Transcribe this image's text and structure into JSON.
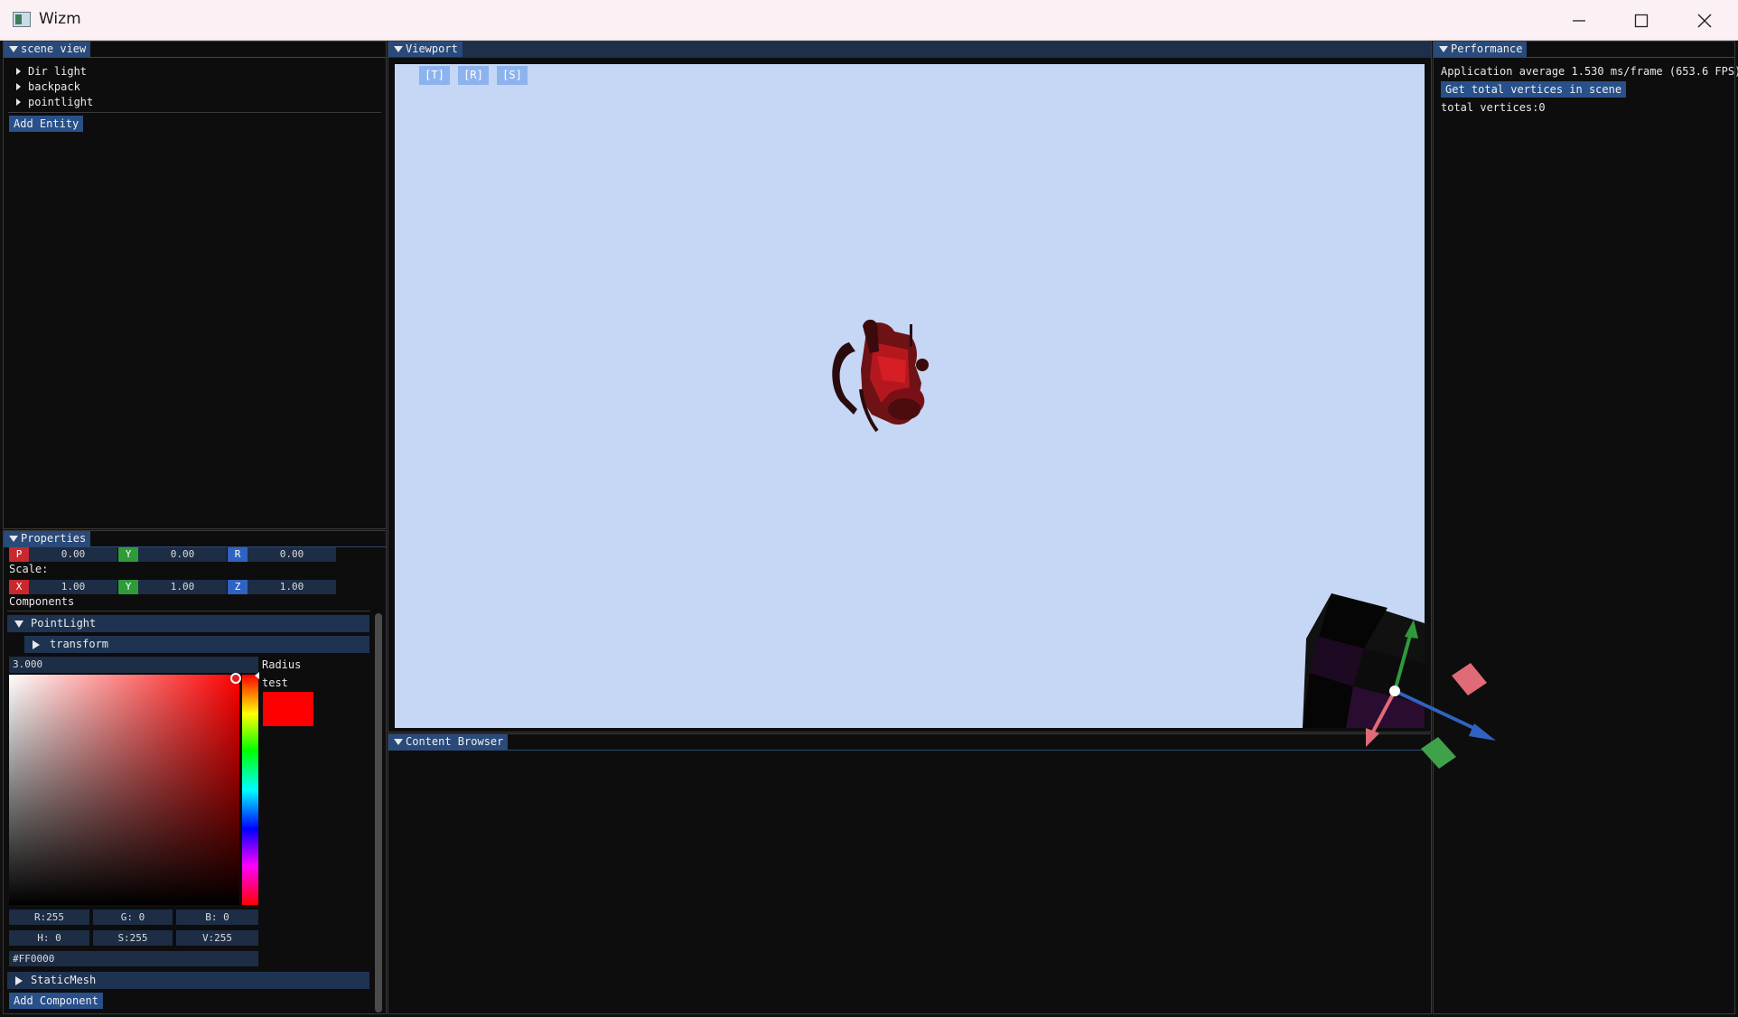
{
  "window": {
    "title": "Wizm",
    "minimize_icon": "minimize-icon",
    "maximize_icon": "maximize-icon",
    "close_icon": "close-icon"
  },
  "scene_view": {
    "tab": "scene view",
    "entities": [
      {
        "label": "Dir light"
      },
      {
        "label": "backpack"
      },
      {
        "label": "pointlight"
      }
    ],
    "add_entity": "Add Entity"
  },
  "properties": {
    "tab": "Properties",
    "position": {
      "label_x": "P",
      "x": "0.00",
      "label_y": "Y",
      "y": "0.00",
      "label_z": "R",
      "z": "0.00"
    },
    "scale_label": "Scale:",
    "scale": {
      "label_x": "X",
      "x": "1.00",
      "label_y": "Y",
      "y": "1.00",
      "label_z": "Z",
      "z": "1.00"
    },
    "components_label": "Components",
    "point_light": {
      "header": "PointLight",
      "transform_header": "transform",
      "radius_value": "3.000",
      "radius_label": "Radius",
      "color_label": "test",
      "color_hex_swatch": "#FF0000",
      "rgb": {
        "r": "R:255",
        "g": "G:  0",
        "b": "B:  0"
      },
      "hsv": {
        "h": "H:  0",
        "s": "S:255",
        "v": "V:255"
      },
      "hex_value": "#FF0000"
    },
    "static_mesh_header": "StaticMesh",
    "add_component": "Add Component"
  },
  "viewport": {
    "tab": "Viewport",
    "tools": {
      "translate": "[T]",
      "rotate": "[R]",
      "scale": "[S]"
    },
    "background_color": "#c5d7f4",
    "model": "backpack"
  },
  "content_browser": {
    "tab": "Content Browser"
  },
  "performance": {
    "tab": "Performance",
    "fps_text": "Application average 1.530 ms/frame (653.6 FPS)",
    "vertices_button": "Get total vertices in scene",
    "vertices_text": "total vertices:0"
  },
  "colors": {
    "accent_blue": "#294a7a",
    "axis_red": "#c9282e",
    "axis_green": "#2f9a3a",
    "axis_blue": "#2f63c2"
  }
}
